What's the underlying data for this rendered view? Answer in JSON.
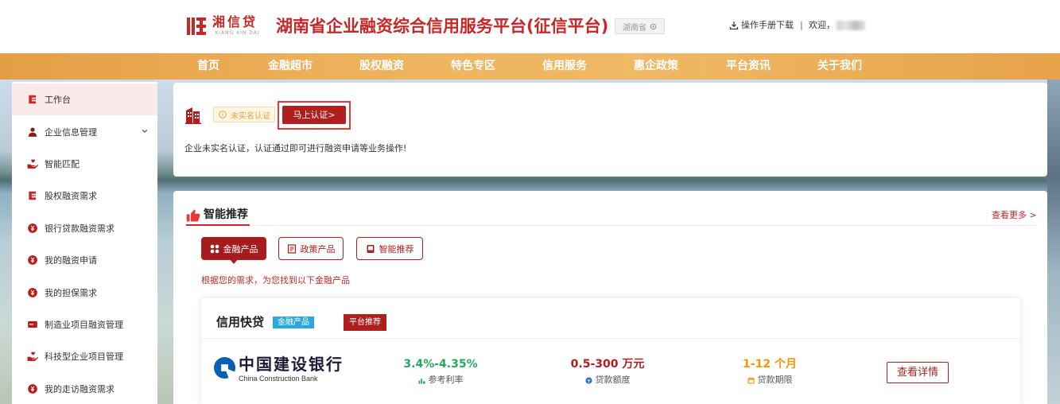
{
  "header": {
    "logo_text": "湘信贷",
    "logo_subtext": "XIANG XIN DAI",
    "title": "湖南省企业融资综合信用服务平台(征信平台)",
    "location": "湖南省",
    "location_icon": "location-pin-icon",
    "download_icon": "download-icon",
    "manual_download": "操作手册下载",
    "separator": "|",
    "welcome": "欢迎，"
  },
  "nav": {
    "items": [
      "首页",
      "金融超市",
      "股权融资",
      "特色专区",
      "信用服务",
      "惠企政策",
      "平台资讯",
      "关于我们"
    ]
  },
  "sidebar": {
    "items": [
      {
        "label": "工作台",
        "icon": "workbench-icon",
        "active": true
      },
      {
        "label": "企业信息管理",
        "icon": "user-icon",
        "expandable": true
      },
      {
        "label": "智能匹配",
        "icon": "hand-heart-icon"
      },
      {
        "label": "股权融资需求",
        "icon": "workbench-icon"
      },
      {
        "label": "银行贷款融资需求",
        "icon": "yuan-circle-icon"
      },
      {
        "label": "我的融资申请",
        "icon": "yuan-circle-icon"
      },
      {
        "label": "我的担保需求",
        "icon": "yuan-circle-icon"
      },
      {
        "label": "制造业项目融资管理",
        "icon": "card-icon"
      },
      {
        "label": "科技型企业项目管理",
        "icon": "hand-heart-icon"
      },
      {
        "label": "我的走访融资需求",
        "icon": "yuan-circle-icon"
      }
    ]
  },
  "verify_card": {
    "icon": "building-icon",
    "status_badge": "未实名认证",
    "verify_button": "马上认证>",
    "message": "企业未实名认证，认证通过即可进行融资申请等业务操作!"
  },
  "recommend": {
    "title": "智能推荐",
    "title_icon": "thumbs-up-icon",
    "more_link": "查看更多 >",
    "tabs": [
      {
        "label": "金融产品",
        "icon": "grid-icon",
        "active": true
      },
      {
        "label": "政策产品",
        "icon": "document-icon"
      },
      {
        "label": "智能推荐",
        "icon": "tablet-icon"
      }
    ],
    "hint": "根据您的需求，为您找到以下金融产品",
    "product": {
      "name": "信用快贷",
      "type_badge": "金融产品",
      "recommend_badge": "平台推荐",
      "bank_name_cn": "中国建设银行",
      "bank_name_en": "China Construction Bank",
      "metrics": [
        {
          "value": "3.4%-4.35%",
          "label": "参考利率",
          "icon": "rate-icon",
          "color": "#2aa862"
        },
        {
          "value": "0.5-300 万元",
          "label": "贷款额度",
          "icon": "amount-icon",
          "color": "#b01e1e"
        },
        {
          "value": "1-12 个月",
          "label": "贷款期限",
          "icon": "calendar-icon",
          "color": "#f39800"
        }
      ],
      "detail_button": "查看详情"
    }
  },
  "colors": {
    "brand_red": "#c62828",
    "accent_dark_red": "#b01e1e",
    "nav_orange": "#eaa74e",
    "badge_blue": "#2aa7e1",
    "warning_yellow": "#e6a23c"
  }
}
